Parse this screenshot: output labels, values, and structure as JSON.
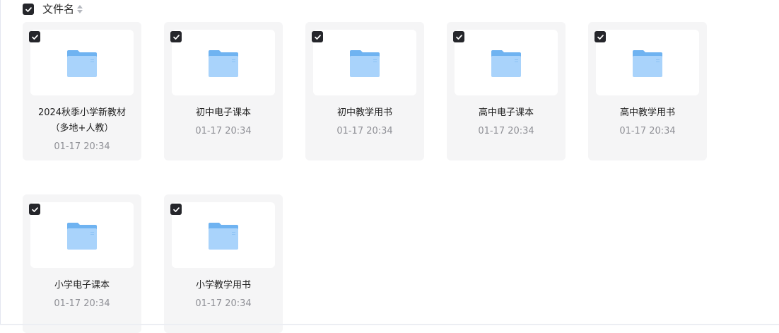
{
  "header": {
    "column_label": "文件名"
  },
  "files": [
    {
      "name": "2024秋季小学新教材\n（多地+人教）",
      "time": "01-17 20:34"
    },
    {
      "name": "初中电子课本",
      "time": "01-17 20:34"
    },
    {
      "name": "初中教学用书",
      "time": "01-17 20:34"
    },
    {
      "name": "高中电子课本",
      "time": "01-17 20:34"
    },
    {
      "name": "高中教学用书",
      "time": "01-17 20:34"
    },
    {
      "name": "小学电子课本",
      "time": "01-17 20:34"
    },
    {
      "name": "小学教学用书",
      "time": "01-17 20:34"
    }
  ],
  "colors": {
    "checkbox": "#25262b",
    "card_bg": "#f5f5f6",
    "folder_front": "#a9d3fb",
    "folder_back": "#6fb3f1",
    "time_text": "#8f9096"
  }
}
